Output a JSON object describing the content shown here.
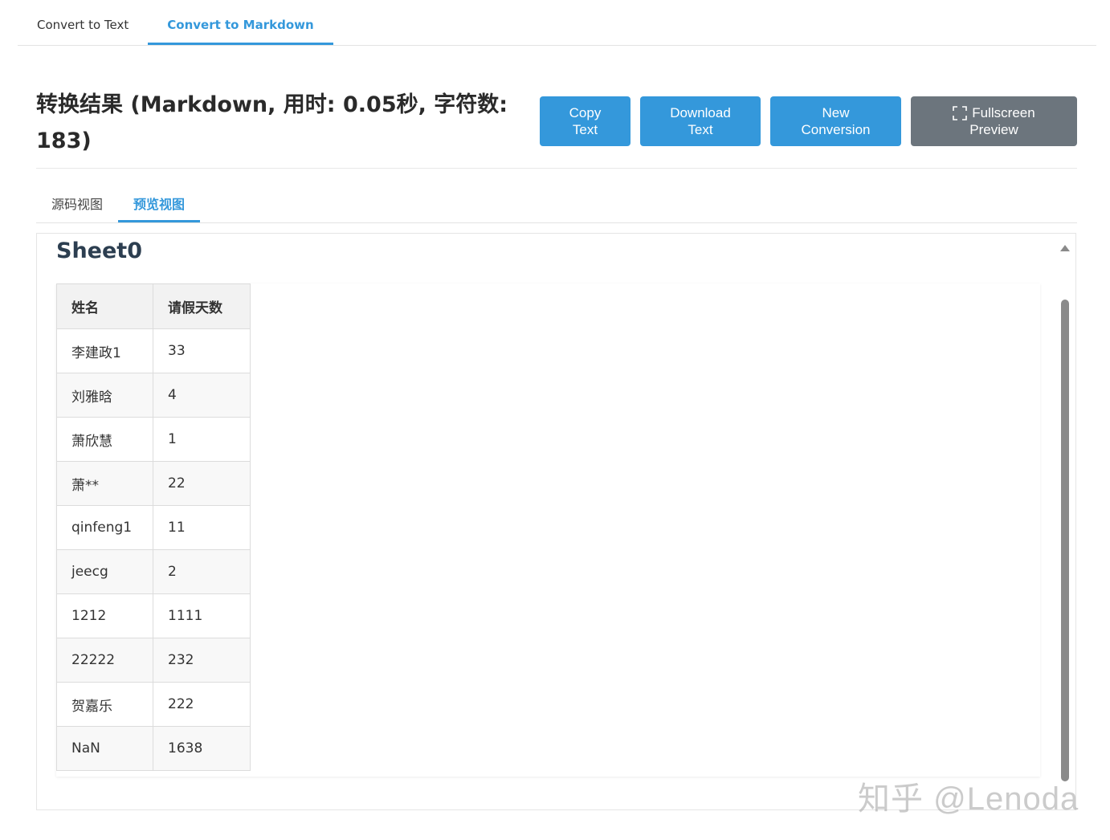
{
  "top_tabs": [
    {
      "label": "Convert to Text",
      "active": false
    },
    {
      "label": "Convert to Markdown",
      "active": true
    }
  ],
  "result_title": "转换结果 (Markdown, 用时: 0.05秒, 字符数: 183)",
  "buttons": {
    "copy": {
      "line1": "Copy",
      "line2": "Text"
    },
    "download": {
      "line1": "Download",
      "line2": "Text"
    },
    "new_conversion": {
      "line1": "New",
      "line2": "Conversion"
    },
    "fullscreen": {
      "line1": "Fullscreen",
      "line2": "Preview",
      "icon": "fullscreen-icon"
    }
  },
  "sub_tabs": [
    {
      "label": "源码视图",
      "active": false
    },
    {
      "label": "预览视图",
      "active": true
    }
  ],
  "preview": {
    "sheet_title": "Sheet0",
    "table": {
      "headers": [
        "姓名",
        "请假天数"
      ],
      "rows": [
        [
          "李建政1",
          "33"
        ],
        [
          "刘雅晗",
          "4"
        ],
        [
          "萧欣慧",
          "1"
        ],
        [
          "萧**",
          "22"
        ],
        [
          "qinfeng1",
          "11"
        ],
        [
          "jeecg",
          "2"
        ],
        [
          "1212",
          "1111"
        ],
        [
          "22222",
          "232"
        ],
        [
          "贺嘉乐",
          "222"
        ],
        [
          "NaN",
          "1638"
        ]
      ]
    }
  },
  "watermark": "知乎 @Lenoda",
  "colors": {
    "accent": "#3498db",
    "gray_button": "#6c757d"
  }
}
